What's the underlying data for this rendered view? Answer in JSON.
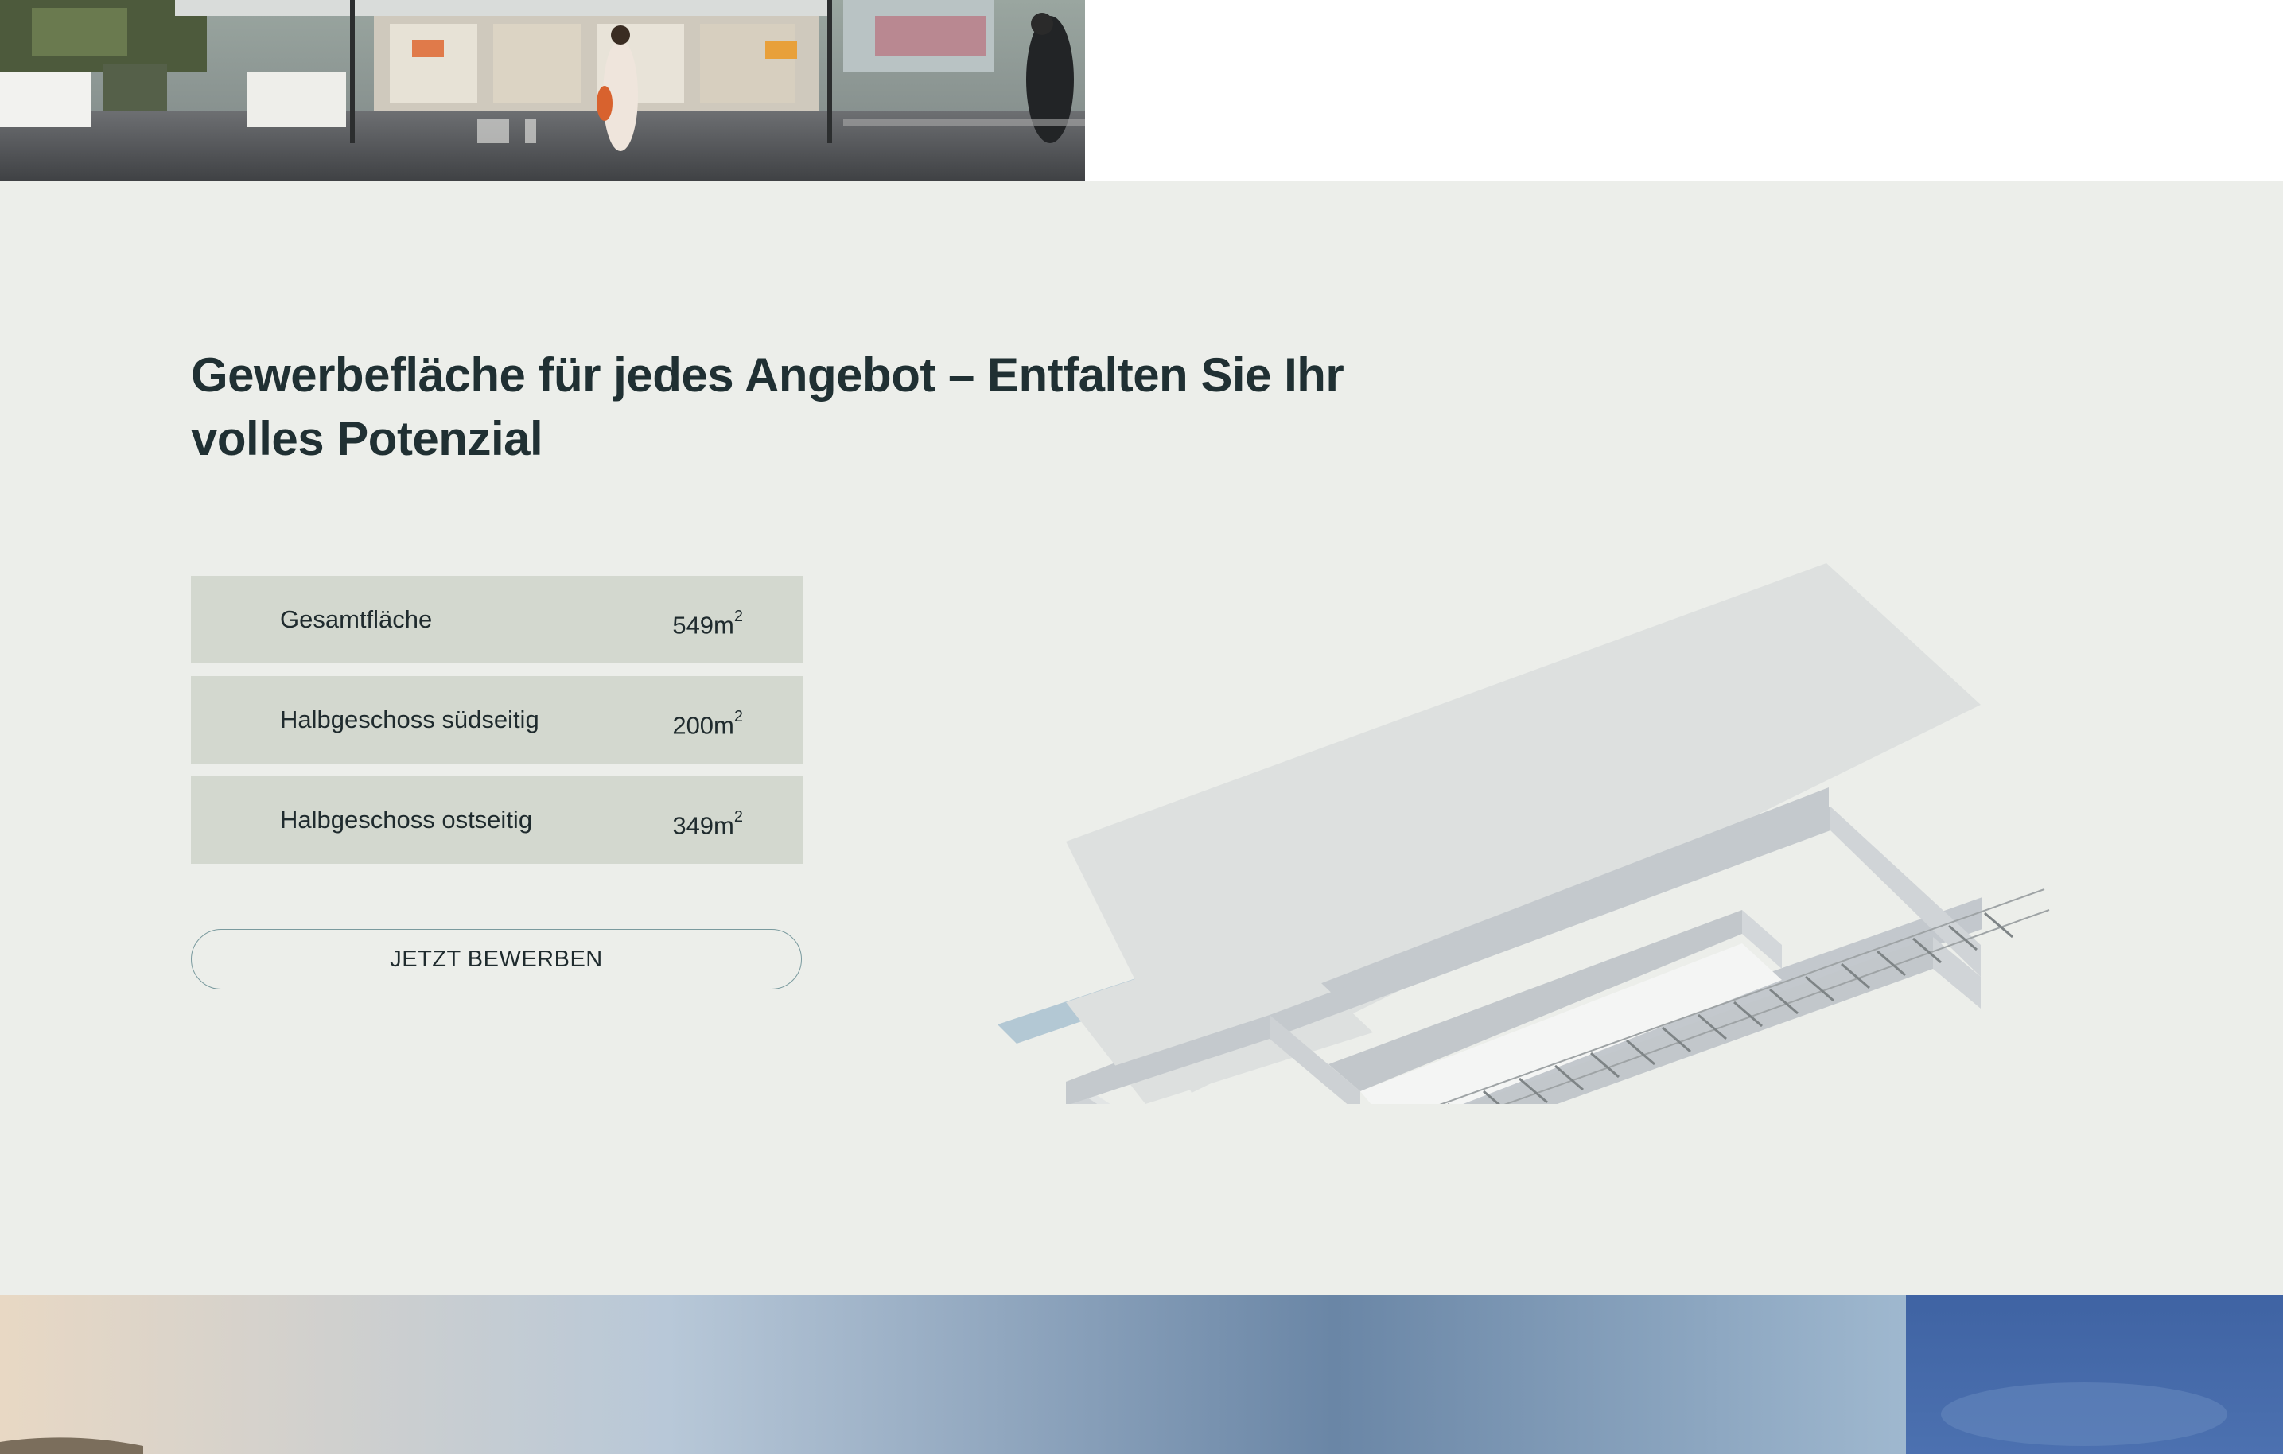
{
  "hero_image": {
    "alt": ""
  },
  "section": {
    "headline": "Gewerbefläche für jedes Angebot – Entfalten Sie Ihr volles Potenzial",
    "areas": [
      {
        "label": "Gesamtfläche",
        "value": "549m",
        "unit_sup": "2"
      },
      {
        "label": "Halbgeschoss südseitig",
        "value": "200m",
        "unit_sup": "2"
      },
      {
        "label": "Halbgeschoss ostseitig",
        "value": "349m",
        "unit_sup": "2"
      }
    ],
    "cta_label": "JETZT BEWERBEN"
  },
  "colors": {
    "background": "#eceeea",
    "row_background": "#d3d8cf",
    "text": "#203033",
    "button_border": "#7a9a9e",
    "water_strip": "#b3c8d4",
    "building": "#c6cbcf"
  }
}
